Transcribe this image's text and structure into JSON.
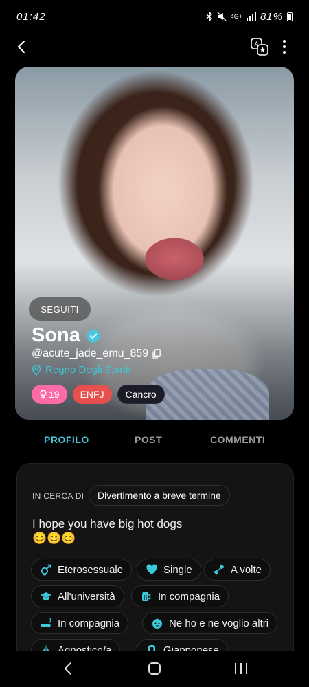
{
  "status": {
    "time": "01:42",
    "network": "4G+",
    "battery": "81%"
  },
  "profile": {
    "followed_label": "SEGUITI",
    "name": "Sona",
    "username": "@acute_jade_emu_859",
    "location": "Regno Degli Spiriti",
    "tags": {
      "age": "19",
      "mbti": "ENFJ",
      "zodiac": "Cancro"
    }
  },
  "tabs": [
    "PROFILO",
    "POST",
    "COMMENTI"
  ],
  "info": {
    "looking_label": "IN CERCA DI",
    "looking_value": "Divertimento a breve termine",
    "bio_line1": "I hope you have big hot dogs",
    "bio_line2": "😊😊😊",
    "chips": [
      {
        "icon": "gender-icon",
        "label": "Eterosessuale"
      },
      {
        "icon": "heart-icon",
        "label": "Single"
      },
      {
        "icon": "dumbbell-icon",
        "label": "A volte"
      },
      {
        "icon": "graduation-cap-icon",
        "label": "All'università"
      },
      {
        "icon": "beer-mug-icon",
        "label": "In compagnia"
      },
      {
        "icon": "cigarette-icon",
        "label": "In compagnia"
      },
      {
        "icon": "baby-icon",
        "label": "Ne ho e ne voglio altri"
      },
      {
        "icon": "praying-hands-icon",
        "label": "Agnostico/a"
      },
      {
        "icon": "language-icon",
        "label": "Giapponese"
      }
    ]
  },
  "colors": {
    "accent": "#49c7e0",
    "age_tag": "#ff6aa8",
    "mbti_tag": "#e8504f",
    "chip_icon": "#3cc8d8"
  }
}
